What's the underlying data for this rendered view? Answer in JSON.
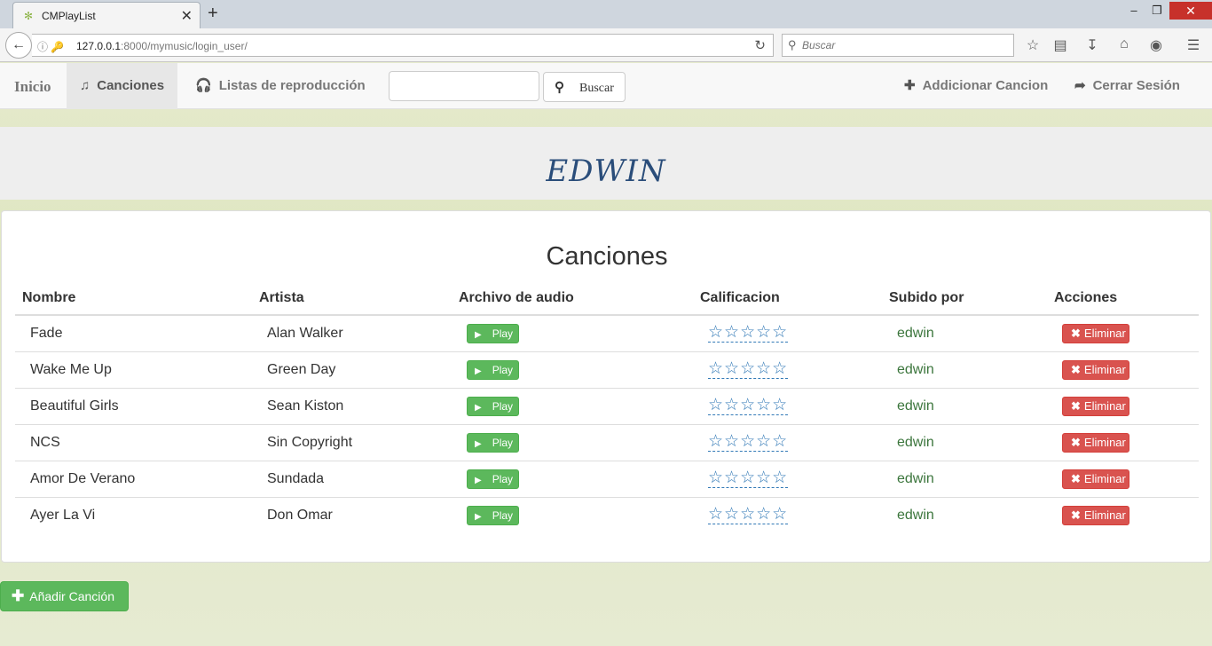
{
  "browser": {
    "tab_title": "CMPlayList",
    "url_host": "127.0.0.1",
    "url_rest": ":8000/mymusic/login_user/",
    "search_placeholder": "Buscar"
  },
  "nav": {
    "brand": "Inicio",
    "songs": "Canciones",
    "playlists": "Listas de reproducción",
    "search_value": "",
    "search_button": "Buscar",
    "add_song": "Addicionar Cancion",
    "logout": "Cerrar Sesión"
  },
  "user_header": "EDWIN",
  "panel": {
    "title": "Canciones",
    "columns": [
      "Nombre",
      "Artista",
      "Archivo de audio",
      "Calificacion",
      "Subido por",
      "Acciones"
    ],
    "play_label": "Play",
    "delete_label": "Eliminar",
    "rows": [
      {
        "name": "Fade",
        "artist": "Alan Walker",
        "user": "edwin",
        "rating": 0
      },
      {
        "name": "Wake Me Up",
        "artist": "Green Day",
        "user": "edwin",
        "rating": 0
      },
      {
        "name": "Beautiful Girls",
        "artist": "Sean Kiston",
        "user": "edwin",
        "rating": 0
      },
      {
        "name": "NCS",
        "artist": "Sin Copyright",
        "user": "edwin",
        "rating": 0
      },
      {
        "name": "Amor De Verano",
        "artist": "Sundada",
        "user": "edwin",
        "rating": 0
      },
      {
        "name": "Ayer La Vi",
        "artist": "Don Omar",
        "user": "edwin",
        "rating": 0
      }
    ]
  },
  "add_song_button": "Añadir Canción",
  "icons": {
    "music": "music-note-icon",
    "headphones": "headphones-icon",
    "search": "search-icon",
    "plus": "plus-icon",
    "logout": "logout-icon",
    "play": "play-icon",
    "remove": "remove-icon",
    "star": "star-outline-icon"
  },
  "colors": {
    "success": "#5cb85c",
    "danger": "#d9534f",
    "link": "#337ab7",
    "user_link": "#3c763d",
    "header_text": "#2a4d7a"
  }
}
